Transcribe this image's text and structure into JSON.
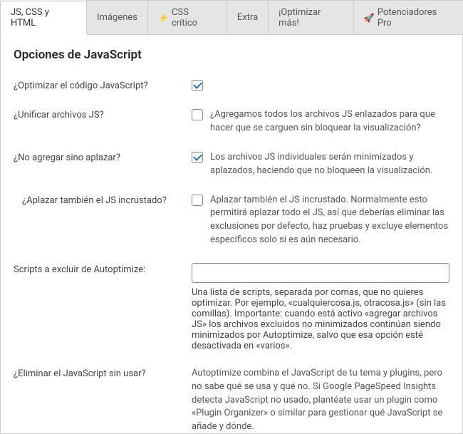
{
  "tabs": {
    "js_css_html": "JS, CSS y HTML",
    "images": "Imágenes",
    "css_critical": "CSS crítico",
    "extra": "Extra",
    "optimize_more": "¡Optimizar más!",
    "pro": "Potenciadores Pro"
  },
  "section_title": "Opciones de JavaScript",
  "rows": {
    "optimize_js": {
      "label": "¿Optimizar el código JavaScript?",
      "checked": true
    },
    "aggregate_js": {
      "label": "¿Unificar archivos JS?",
      "checked": false,
      "desc": "¿Agregamos todos los archivos JS enlazados para que hacer que se carguen sin bloquear la visualización?"
    },
    "defer_not_aggregate": {
      "label": "¿No agregar sino aplazar?",
      "checked": true,
      "desc": "Los archivos JS individuales serán minimizados y aplazados, haciendo que no bloqueen la visualización."
    },
    "defer_inline": {
      "label": "¿Aplazar también el JS incrustado?",
      "checked": false,
      "desc": "Aplazar también el JS incrustado. Normalmente esto permitirá aplazar todo el JS, así que deberías eliminar las exclusiones por defecto, haz pruebas y excluye elementos específicos solo si es aún necesario."
    },
    "exclude_scripts": {
      "label": "Scripts a excluir de Autoptimize:",
      "value": "",
      "desc": "Una lista de scripts, separada por comas, que no quieres optimizar. Por ejemplo, «cualquiercosa.js, otracosa.js» (sin las comillas). Importante: cuando está activo «agregar archivos JS» los archivos excluidos no minimizados continúan siendo minimizados por Autoptimize, salvo que esa opción esté desactivada en «varios»."
    },
    "remove_unused_js": {
      "label": "¿Eliminar el JavaScript sin usar?",
      "desc": "Autoptimize combina el JavaScript de tu tema y plugins, pero no sabe qué se usa y qué no. Si Google PageSpeed Insights detecta JavaScript no usado, plantéate usar un plugin como «Plugin Organizer» o similar para gestionar qué JavaScript se añade y dónde."
    }
  }
}
